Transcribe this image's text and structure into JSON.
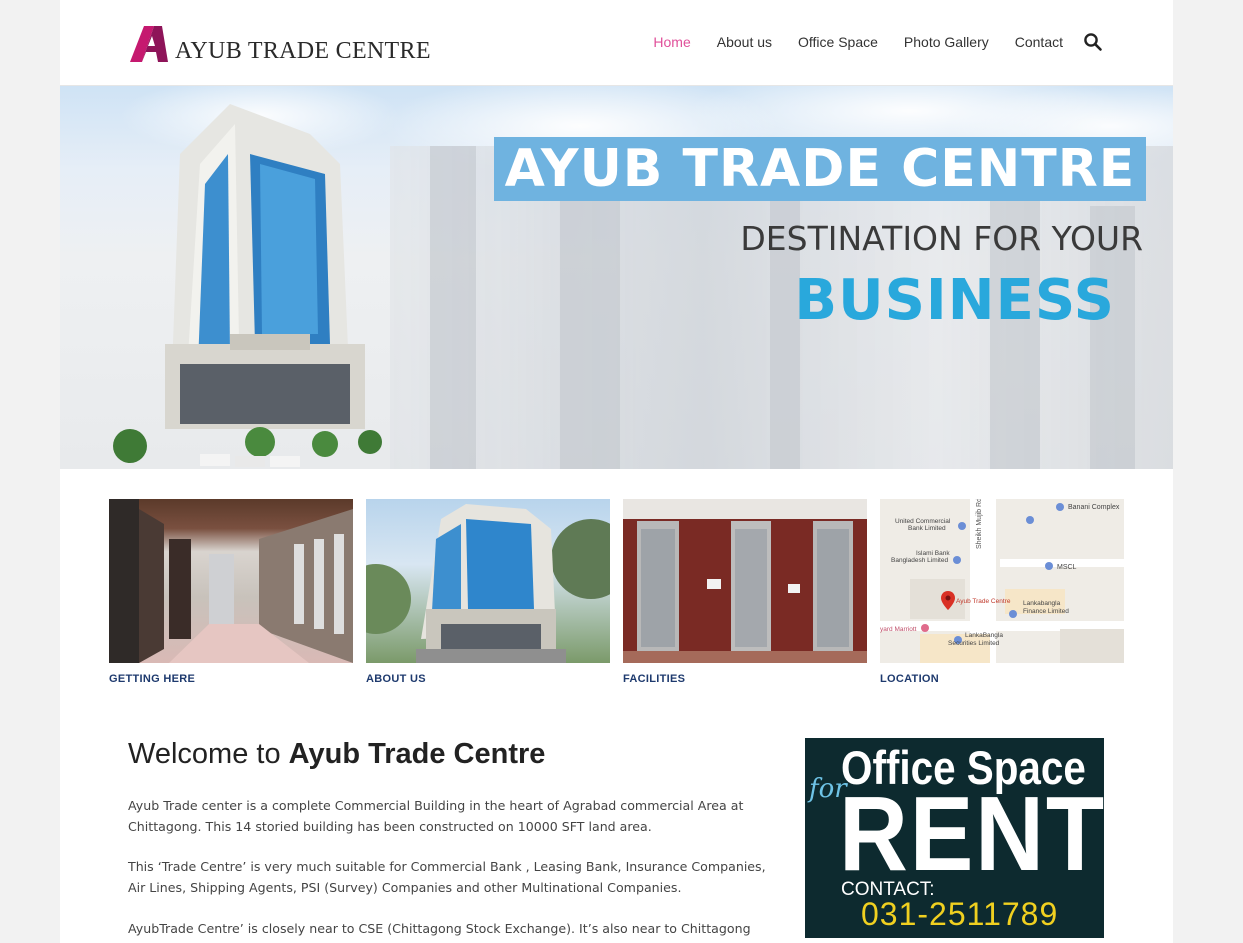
{
  "header": {
    "logo_text": "AYUB TRADE CENTRE",
    "brand_color": "#c5196f",
    "nav": [
      {
        "label": "Home",
        "active": true
      },
      {
        "label": "About us",
        "active": false
      },
      {
        "label": "Office Space",
        "active": false
      },
      {
        "label": "Photo Gallery",
        "active": false
      },
      {
        "label": "Contact",
        "active": false
      }
    ],
    "search_icon": "search-icon",
    "active_color": "#e0509a"
  },
  "hero": {
    "title": "AYUB TRADE CENTRE",
    "subtitle": "DESTINATION FOR YOUR",
    "highlight": "BUSINESS",
    "title_bg_color": "#6fb3e0",
    "highlight_color": "#29a8dc"
  },
  "tiles": [
    {
      "label": "GETTING HERE",
      "image": "lobby-interior"
    },
    {
      "label": "ABOUT US",
      "image": "building-exterior"
    },
    {
      "label": "FACILITIES",
      "image": "elevators"
    },
    {
      "label": "LOCATION",
      "image": "map",
      "map_labels": {
        "banani": "Banani Complex",
        "united_commercial": "United Commercial",
        "bank_limited": "Bank Limited",
        "islami_bank": "Islami Bank",
        "bangladesh_limited": "Bangladesh Limited",
        "road": "Sheikh Mujib Rd",
        "mscl": "MSCL",
        "atc": "Ayub Trade Centre",
        "lankabangla_finance": "Lankabangla",
        "finance_limited": "Finance Limited",
        "marriott": "yard Marriott",
        "lankabangla_securities": "LankaBangla",
        "securities_limited": "Securities Limited"
      }
    }
  ],
  "welcome": {
    "prefix": "Welcome to",
    "name": "Ayub Trade Centre",
    "paragraphs": [
      "Ayub Trade center is a complete Commercial Building in the heart of Agrabad commercial Area at Chittagong. This 14 storied building has been constructed on 10000 SFT land area.",
      "This ‘Trade Centre’ is very much suitable for Commercial Bank , Leasing Bank, Insurance Companies, Air Lines, Shipping Agents, PSI (Survey) Companies and other Multinational Companies.",
      "AyubTrade Centre’  is closely near to CSE (Chittagong Stock Exchange). It’s also near to Chittagong Sea Port,"
    ]
  },
  "ad": {
    "for": "for",
    "office_space": "Office Space",
    "rent": "RENT",
    "contact_label": "CONTACT:",
    "phone": "031-2511789",
    "bg_color": "#0d2a2f",
    "phone_color": "#f0d020"
  }
}
